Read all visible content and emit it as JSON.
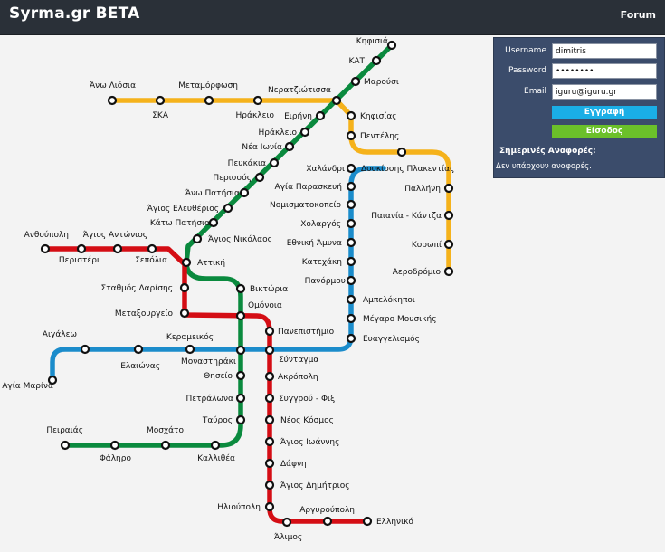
{
  "header": {
    "brand": "Syrma.gr BETA",
    "forum_label": "Forum"
  },
  "login_panel": {
    "username_label": "Username",
    "username_value": "dimitris",
    "password_label": "Password",
    "password_value": "dimitris",
    "email_label": "Email",
    "email_value": "iguru@iguru.gr",
    "register_label": "Εγγραφή",
    "login_label": "Είσοδος",
    "reports_title": "Σημερινές Αναφορές:",
    "reports_empty": "Δεν υπάρχουν αναφορές."
  },
  "colors": {
    "line_green": "#0a8a3e",
    "line_red": "#d40d14",
    "line_blue": "#1b8ccb",
    "line_yellow": "#f5b21b",
    "header_bg": "#2a3038",
    "panel_bg": "#3b4c6b"
  },
  "map": {
    "stations": [
      {
        "id": "kifisia",
        "name": "Κηφισιά"
      },
      {
        "id": "kat",
        "name": "ΚΑΤ"
      },
      {
        "id": "marousi",
        "name": "Μαρούσι"
      },
      {
        "id": "neratziotissa",
        "name": "Νερατζιώτισσα"
      },
      {
        "id": "eirini",
        "name": "Ειρήνη"
      },
      {
        "id": "iraklio",
        "name": "Ηράκλειο"
      },
      {
        "id": "nea_ionia",
        "name": "Νέα Ιωνία"
      },
      {
        "id": "pefkakia",
        "name": "Πευκάκια"
      },
      {
        "id": "perissos",
        "name": "Περισσός"
      },
      {
        "id": "ano_patisia",
        "name": "Άνω Πατήσια"
      },
      {
        "id": "ag_eleftherios",
        "name": "Άγιος Ελευθέριος"
      },
      {
        "id": "kato_patisia",
        "name": "Κάτω Πατήσια"
      },
      {
        "id": "ag_nikolaos",
        "name": "Άγιος Νικόλαος"
      },
      {
        "id": "attiki",
        "name": "Αττική"
      },
      {
        "id": "viktoria",
        "name": "Βικτώρια"
      },
      {
        "id": "omonoia",
        "name": "Ομόνοια"
      },
      {
        "id": "monastiraki",
        "name": "Μοναστηράκι"
      },
      {
        "id": "thiseio",
        "name": "Θησείο"
      },
      {
        "id": "petralona",
        "name": "Πετράλωνα"
      },
      {
        "id": "tavros",
        "name": "Ταύρος"
      },
      {
        "id": "kallithea",
        "name": "Καλλιθέα"
      },
      {
        "id": "moschato",
        "name": "Μοσχάτο"
      },
      {
        "id": "faliro",
        "name": "Φάληρο"
      },
      {
        "id": "peiraias",
        "name": "Πειραιάς"
      },
      {
        "id": "anthoupoli",
        "name": "Ανθούπολη"
      },
      {
        "id": "peristeri",
        "name": "Περιστέρι"
      },
      {
        "id": "ag_antonios",
        "name": "Άγιος Αντώνιος"
      },
      {
        "id": "sepolia",
        "name": "Σεπόλια"
      },
      {
        "id": "larisis",
        "name": "Σταθμός Λαρίσης"
      },
      {
        "id": "metaxourgeio",
        "name": "Μεταξουργείο"
      },
      {
        "id": "panepistimio",
        "name": "Πανεπιστήμιο"
      },
      {
        "id": "syntagma",
        "name": "Σύνταγμα"
      },
      {
        "id": "akropoli",
        "name": "Ακρόπολη"
      },
      {
        "id": "syngrou_fix",
        "name": "Συγγρού - Φιξ"
      },
      {
        "id": "neos_kosmos",
        "name": "Νέος Κόσμος"
      },
      {
        "id": "ag_ioannis",
        "name": "Άγιος Ιωάννης"
      },
      {
        "id": "dafni",
        "name": "Δάφνη"
      },
      {
        "id": "ag_dimitrios",
        "name": "Άγιος Δημήτριος"
      },
      {
        "id": "ilioupoli",
        "name": "Ηλιούπολη"
      },
      {
        "id": "alimos",
        "name": "Άλιμος"
      },
      {
        "id": "argyroupoli",
        "name": "Αργυρούπολη"
      },
      {
        "id": "elliniko",
        "name": "Ελληνικό"
      },
      {
        "id": "ag_marina",
        "name": "Αγία Μαρίνα"
      },
      {
        "id": "aigaleo",
        "name": "Αιγάλεω"
      },
      {
        "id": "elaionas",
        "name": "Ελαιώνας"
      },
      {
        "id": "kerameikos",
        "name": "Κεραμεικός"
      },
      {
        "id": "evangelismos",
        "name": "Ευαγγελισμός"
      },
      {
        "id": "megaro",
        "name": "Μέγαρο Μουσικής"
      },
      {
        "id": "ampelokipoi",
        "name": "Αμπελόκηποι"
      },
      {
        "id": "panormou",
        "name": "Πανόρμου"
      },
      {
        "id": "katechaki",
        "name": "Κατεχάκη"
      },
      {
        "id": "ethniki_amyna",
        "name": "Εθνική Άμυνα"
      },
      {
        "id": "cholargos",
        "name": "Χολαργός"
      },
      {
        "id": "nomismatokopeio",
        "name": "Νομισματοκοπείο"
      },
      {
        "id": "ag_paraskevi",
        "name": "Αγία Παρασκευή"
      },
      {
        "id": "chalandri",
        "name": "Χαλάνδρι"
      },
      {
        "id": "doukissis",
        "name": "Δουκίσσης Πλακεντίας"
      },
      {
        "id": "pallini",
        "name": "Παλλήνη"
      },
      {
        "id": "paiania",
        "name": "Παιανία - Κάντζα"
      },
      {
        "id": "koropi",
        "name": "Κορωπί"
      },
      {
        "id": "aerodromio",
        "name": "Αεροδρόμιο"
      },
      {
        "id": "pentelis",
        "name": "Πεντέλης"
      },
      {
        "id": "kifisias",
        "name": "Κηφισίας"
      },
      {
        "id": "ano_liosia",
        "name": "Άνω Λιόσια"
      },
      {
        "id": "ska",
        "name": "ΣΚΑ"
      },
      {
        "id": "metamorfosi",
        "name": "Μεταμόρφωση"
      },
      {
        "id": "iraklio_suburban",
        "name": "Ηράκλειο"
      }
    ]
  }
}
